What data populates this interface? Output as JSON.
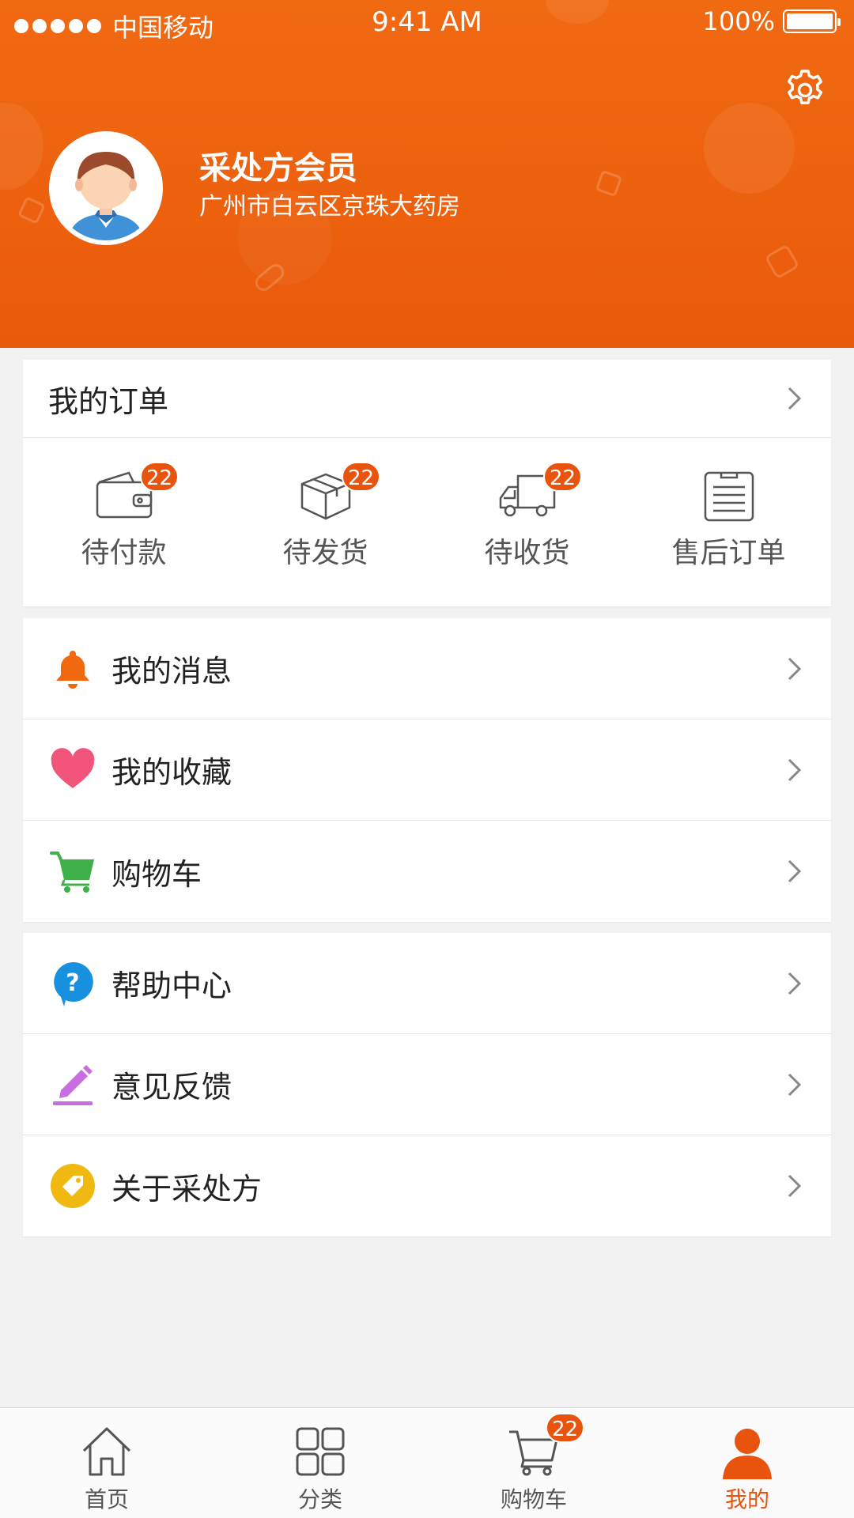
{
  "status_bar": {
    "carrier": "中国移动",
    "time": "9:41 AM",
    "battery": "100%",
    "battery_level": 1.0
  },
  "profile": {
    "name": "采处方会员",
    "store": "广州市白云区京珠大药房",
    "settings_icon": "gear-icon",
    "avatar_icon": "avatar-illustration"
  },
  "orders": {
    "title": "我的订单",
    "items": [
      {
        "label": "待付款",
        "badge": "22",
        "icon": "wallet-icon"
      },
      {
        "label": "待发货",
        "badge": "22",
        "icon": "package-icon"
      },
      {
        "label": "待收货",
        "badge": "22",
        "icon": "truck-icon"
      },
      {
        "label": "售后订单",
        "badge": "",
        "icon": "clipboard-icon"
      }
    ]
  },
  "menu_group_1": [
    {
      "label": "我的消息",
      "icon": "bell-icon",
      "color": "#f0680f"
    },
    {
      "label": "我的收藏",
      "icon": "heart-icon",
      "color": "#f2557a"
    },
    {
      "label": "购物车",
      "icon": "cart-icon",
      "color": "#3fb04a"
    }
  ],
  "menu_group_2": [
    {
      "label": "帮助中心",
      "icon": "help-icon",
      "color": "#1790e0"
    },
    {
      "label": "意见反馈",
      "icon": "pencil-icon",
      "color": "#c96ee0"
    },
    {
      "label": "关于采处方",
      "icon": "tag-icon",
      "color": "#efb912"
    }
  ],
  "tabbar": {
    "items": [
      {
        "label": "首页",
        "icon": "home-icon",
        "active": false
      },
      {
        "label": "分类",
        "icon": "category-icon",
        "active": false
      },
      {
        "label": "购物车",
        "icon": "cart-icon",
        "active": false,
        "badge": "22"
      },
      {
        "label": "我的",
        "icon": "person-icon",
        "active": true
      }
    ]
  },
  "colors": {
    "brand": "#ea5a0b",
    "badge": "#e8530e",
    "background": "#f2f2f2"
  }
}
